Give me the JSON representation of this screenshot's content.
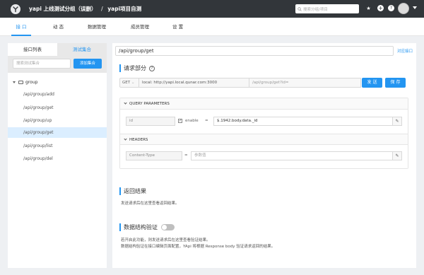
{
  "header": {
    "breadcrumb_group": "yapi 上线测试分组（误删）",
    "breadcrumb_sep": "/",
    "breadcrumb_project": "yapi项目自测",
    "search_placeholder": "搜索分组/项目"
  },
  "nav": {
    "tabs": [
      "接 口",
      "动 态",
      "数据管理",
      "成员管理",
      "设 置"
    ],
    "active": 0
  },
  "sidebar": {
    "tab_interfaces": "接口列表",
    "tab_collections": "测试集合",
    "search_placeholder": "搜索测试集合",
    "add_button": "添加集合",
    "group_name": "group",
    "items": [
      "/api/group/add",
      "/api/group/get",
      "/api/group/up",
      "/api/group/get",
      "/api/group/list",
      "/api/group/del"
    ],
    "active_index": 3
  },
  "main": {
    "path_title": "/api/group/get",
    "corresponding_link": "对应接口",
    "request_section_title": "请求部分",
    "method": "GET",
    "host": "local:  http://yapi.local.qunar.com:3000",
    "full_path": "/api/group/get?id=",
    "send_button": "发 送",
    "save_button": "保 存",
    "query_header": "QUERY PARAMETERS",
    "query_key": "id",
    "query_enable_label": "enable",
    "query_eq": "=",
    "query_value": "$.1942.body.data._id",
    "headers_header": "HEADERS",
    "header_key": "Content-Type",
    "header_eq": "=",
    "header_value_placeholder": "参数值",
    "response_title": "返回结果",
    "response_desc": "发送请求后在这里查看返回结果。",
    "validation_title": "数据结构验证",
    "validation_desc_1": "若开启此功能，则发送请求后在这里查看验证结果。",
    "validation_desc_2": "数据结构验证在接口编辑页面配置，YApi 将根据 Response body 验证请求返回的结果。"
  },
  "colors": {
    "topbar": "#32363a",
    "accent": "#2395f1",
    "page_bg": "#eef0f3",
    "active_row": "#dbeeff"
  }
}
